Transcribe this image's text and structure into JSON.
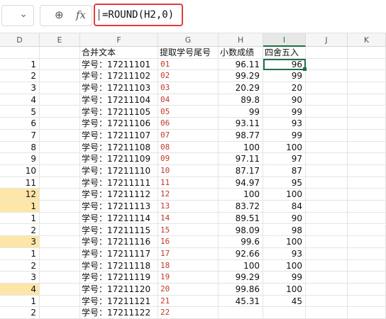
{
  "namebox": {
    "dropdown_icon": "chevron-down-icon"
  },
  "formula_bar": {
    "zoom_icon": "zoom-icon",
    "fx_label": "fx",
    "formula": "=ROUND(H2,0)"
  },
  "columns": [
    "D",
    "E",
    "F",
    "G",
    "H",
    "I",
    "J",
    "K"
  ],
  "active_column": "I",
  "header_row": {
    "F": "合并文本",
    "G": "提取学号尾号",
    "H": "小数成绩",
    "I": "四舍五入"
  },
  "rows": [
    {
      "D": "1",
      "F": "学号：17211101",
      "G": "01",
      "H": "96.11",
      "I": "96",
      "hl": false
    },
    {
      "D": "2",
      "F": "学号：17211102",
      "G": "02",
      "H": "99.29",
      "I": "99",
      "hl": false
    },
    {
      "D": "3",
      "F": "学号：17211103",
      "G": "03",
      "H": "20.29",
      "I": "20",
      "hl": false
    },
    {
      "D": "4",
      "F": "学号：17211104",
      "G": "04",
      "H": "89.8",
      "I": "90",
      "hl": false
    },
    {
      "D": "5",
      "F": "学号：17211105",
      "G": "05",
      "H": "99",
      "I": "99",
      "hl": false
    },
    {
      "D": "6",
      "F": "学号：17211106",
      "G": "06",
      "H": "93.11",
      "I": "93",
      "hl": false
    },
    {
      "D": "7",
      "F": "学号：17211107",
      "G": "07",
      "H": "98.77",
      "I": "99",
      "hl": false
    },
    {
      "D": "8",
      "F": "学号：17211108",
      "G": "08",
      "H": "100",
      "I": "100",
      "hl": false
    },
    {
      "D": "9",
      "F": "学号：17211109",
      "G": "09",
      "H": "97.11",
      "I": "97",
      "hl": false
    },
    {
      "D": "10",
      "F": "学号：17211110",
      "G": "10",
      "H": "87.17",
      "I": "87",
      "hl": false
    },
    {
      "D": "11",
      "F": "学号：17211111",
      "G": "11",
      "H": "94.97",
      "I": "95",
      "hl": false
    },
    {
      "D": "12",
      "F": "学号：17211112",
      "G": "12",
      "H": "100",
      "I": "100",
      "hl": true
    },
    {
      "D": "1",
      "F": "学号：17211113",
      "G": "13",
      "H": "83.72",
      "I": "84",
      "hl": true
    },
    {
      "D": "1",
      "F": "学号：17211114",
      "G": "14",
      "H": "89.51",
      "I": "90",
      "hl": false
    },
    {
      "D": "2",
      "F": "学号：17211115",
      "G": "15",
      "H": "98.09",
      "I": "98",
      "hl": false
    },
    {
      "D": "3",
      "F": "学号：17211116",
      "G": "16",
      "H": "99.6",
      "I": "100",
      "hl": true
    },
    {
      "D": "1",
      "F": "学号：17211117",
      "G": "17",
      "H": "92.66",
      "I": "93",
      "hl": false
    },
    {
      "D": "2",
      "F": "学号：17211118",
      "G": "18",
      "H": "100",
      "I": "100",
      "hl": false
    },
    {
      "D": "3",
      "F": "学号：17211119",
      "G": "19",
      "H": "99.29",
      "I": "99",
      "hl": false
    },
    {
      "D": "4",
      "F": "学号：17211120",
      "G": "20",
      "H": "99.86",
      "I": "100",
      "hl": true
    },
    {
      "D": "1",
      "F": "学号：17211121",
      "G": "21",
      "H": "45.31",
      "I": "45",
      "hl": false
    },
    {
      "D": "2",
      "F": "学号：17211122",
      "G": "22",
      "H": "",
      "I": "",
      "hl": false
    }
  ],
  "colors": {
    "accent": "#1e7145",
    "highlight": "#fde6a8",
    "code_red": "#c0392b",
    "formula_border": "#e33b3b"
  }
}
